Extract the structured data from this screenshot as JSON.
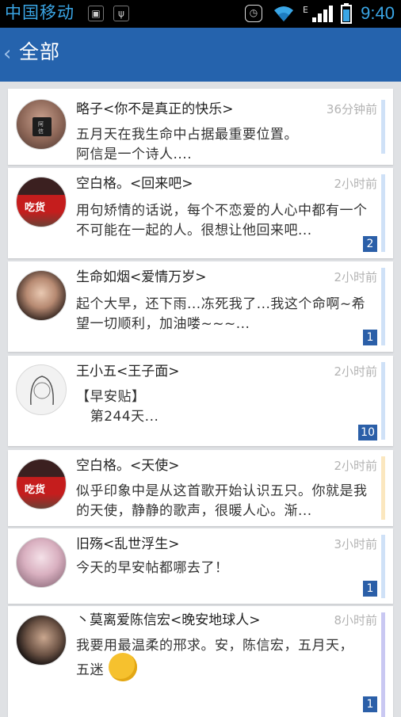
{
  "status_bar": {
    "carrier": "中国移动",
    "time": "9:40"
  },
  "header": {
    "title": "全部"
  },
  "conversations": [
    {
      "name": "略子<你不是真正的快乐>",
      "time": "36分钟前",
      "message": "五月天在我生命中占据最重要位置。\n阿信是一个诗人....",
      "badge": "",
      "bar_color": "#cfe1f7"
    },
    {
      "name": "空白格。<回来吧>",
      "time": "2小时前",
      "message": "用句矫情的话说，每个不恋爱的人心中都有一个不可能在一起的人。很想让他回来吧...",
      "badge": "2",
      "bar_color": "#cfe1f7"
    },
    {
      "name": "生命如烟<爱情万岁>",
      "time": "2小时前",
      "message": "起个大早，还下雨...冻死我了...我这个命啊~希望一切顺利，加油喽~~~...",
      "badge": "1",
      "bar_color": "#cfe1f7"
    },
    {
      "name": "王小五<王子面>",
      "time": "2小时前",
      "message": "【早安贴】\n   第244天...",
      "badge": "10",
      "bar_color": "#cfe1f7"
    },
    {
      "name": "空白格。<天使>",
      "time": "2小时前",
      "message": "似乎印象中是从这首歌开始认识五只。你就是我的天使，静静的歌声，很暖人心。渐...",
      "badge": "",
      "bar_color": "#fbe7bf"
    },
    {
      "name": "旧殇<乱世浮生>",
      "time": "3小时前",
      "message": "今天的早安帖都哪去了！",
      "badge": "1",
      "bar_color": "#cfe1f7"
    },
    {
      "name": "丶莫离爱陈信宏<晚安地球人>",
      "time": "8小时前",
      "message": "我要用最温柔的邢求。安，陈信宏，五月天，五迷",
      "badge": "1",
      "bar_color": "#c9c8f2"
    }
  ]
}
